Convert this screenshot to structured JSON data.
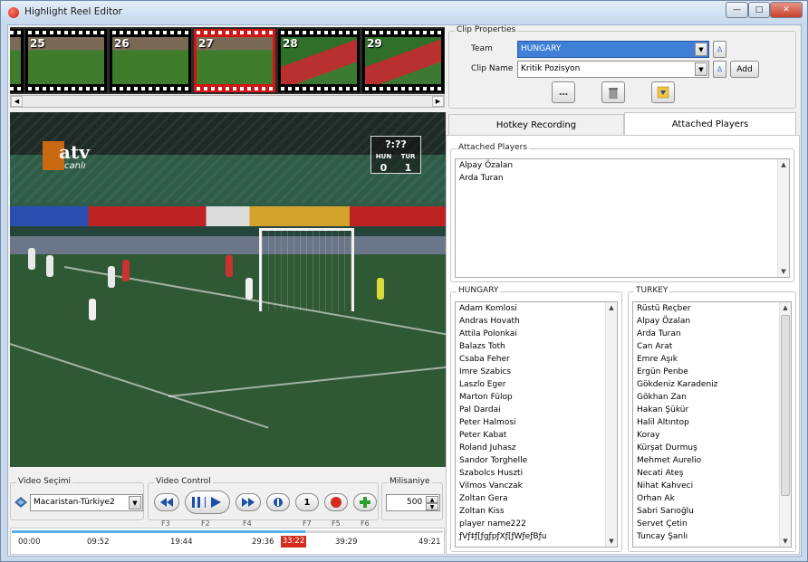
{
  "window": {
    "title": "Highlight Reel Editor",
    "controls": {
      "minimize": "—",
      "maximize": "□",
      "close": "✕"
    }
  },
  "filmstrip": {
    "thumbnails": [
      {
        "number": "25",
        "selected": false
      },
      {
        "number": "26",
        "selected": false
      },
      {
        "number": "27",
        "selected": true
      },
      {
        "number": "28",
        "selected": false
      },
      {
        "number": "29",
        "selected": false
      }
    ]
  },
  "video": {
    "channel_logo": "atv",
    "channel_sub": "canlı",
    "scoreboard": {
      "clock": "?:??",
      "team_home": "HUN",
      "team_away": "TUR",
      "score_home": "0",
      "score_away": "1"
    }
  },
  "video_selection": {
    "group_title": "Video Seçimi",
    "selected_video": "Macaristan-Türkiye2"
  },
  "video_control": {
    "group_title": "Video Control",
    "buttons": [
      {
        "name": "rewind",
        "icon": "rewind-icon",
        "fkey": "F3"
      },
      {
        "name": "play-pause",
        "icon": "play-pause-icon",
        "fkey": "F2"
      },
      {
        "name": "fast-forward",
        "icon": "fast-forward-icon",
        "fkey": "F4"
      },
      {
        "name": "hotkey-mark",
        "icon": "mark-icon",
        "fkey": ""
      },
      {
        "name": "step",
        "icon": "one-icon",
        "label": "1",
        "fkey": "F7"
      },
      {
        "name": "record",
        "icon": "record-icon",
        "fkey": "F5"
      },
      {
        "name": "add",
        "icon": "plus-icon",
        "fkey": "F6"
      }
    ]
  },
  "milliseconds": {
    "group_title": "Milisaniye",
    "value": "500"
  },
  "timeline": {
    "ticks": [
      "00:00",
      "09:52",
      "19:44",
      "29:36",
      "39:29",
      "49:21"
    ],
    "current": "33:22",
    "progress_fraction": 0.68
  },
  "clip_properties": {
    "group_title": "Clip Properties",
    "team_label": "Team",
    "team_value": "HUNGARY",
    "clip_name_label": "Clip Name",
    "clip_name_value": "Kritik Pozisyon",
    "add_label": "Add",
    "action_icons": [
      "more-icon",
      "trash-icon",
      "export-icon"
    ]
  },
  "tabs": [
    {
      "label": "Hotkey Recording",
      "active": false
    },
    {
      "label": "Attached Players",
      "active": true
    }
  ],
  "attached_players": {
    "group_title": "Attached Players",
    "items": [
      "Alpay Özalan",
      "Arda Turan"
    ]
  },
  "hungary": {
    "group_title": "HUNGARY",
    "items": [
      "Adam Komlosi",
      "Andras Hovath",
      "Attila Polonkai",
      "Balazs Toth",
      "Csaba Feher",
      "Imre Szabics",
      "Laszlo Eger",
      "Marton Fülop",
      "Pal Dardai",
      "Peter Halmosi",
      "Peter Kabat",
      "Roland Juhasz",
      "Sandor Torghelle",
      "Szabolcs Huszti",
      "Vilmos Vanczak",
      "Zoltan Gera",
      "Zoltan Kiss",
      "player name222",
      "ƒVƒ‡ƒ[ƒgƒpƒXƒ[ƒWƒeƒBƒu"
    ]
  },
  "turkey": {
    "group_title": "TURKEY",
    "items": [
      "Rüstü Reçber",
      "Alpay Özalan",
      "Arda Turan",
      "Can Arat",
      "Emre Aşık",
      "Ergün Penbe",
      "Gökdeniz Karadeniz",
      "Gökhan Zan",
      "Hakan Şükür",
      "Halil Altıntop",
      "Koray",
      "Kürşat Durmuş",
      "Mehmet Aurelio",
      "Necati Ateş",
      "Nihat Kahveci",
      "Orhan Ak",
      "Sabri Sarıoğlu",
      "Servet Çetin",
      "Tuncay Şanlı"
    ]
  },
  "colors": {
    "selection_blue": "#3f7fd6",
    "record_red": "#d52b1e",
    "timeline_fill": "#5ab1e8"
  }
}
